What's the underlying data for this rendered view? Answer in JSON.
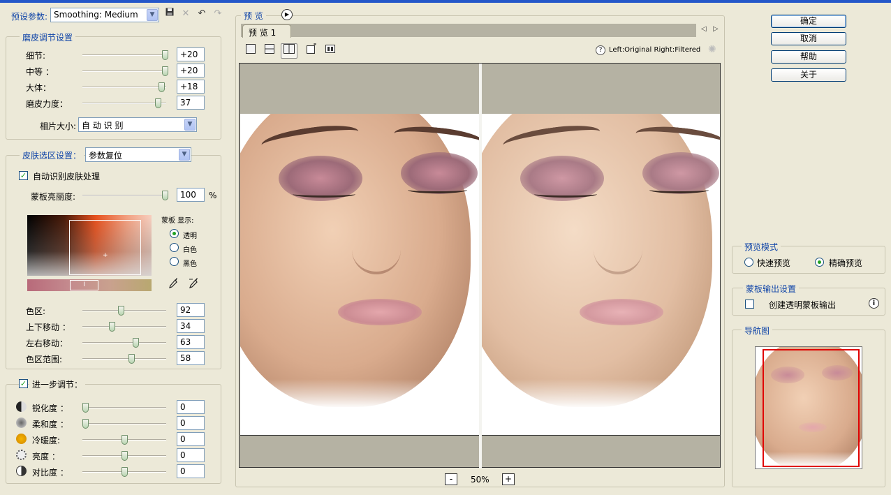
{
  "top": {
    "preset_label": "预设参数:",
    "preset_value": "Smoothing: Medium"
  },
  "smooth": {
    "legend": "磨皮调节设置",
    "rows": [
      {
        "label": "细节:",
        "value": "+20",
        "pos": 0.98
      },
      {
        "label": "中等 ：",
        "value": "+20",
        "pos": 0.98
      },
      {
        "label": "大体：",
        "value": "+18",
        "pos": 0.94
      },
      {
        "label": "磨皮力度：",
        "value": "37",
        "pos": 0.9
      }
    ],
    "photo_size_label": "相片大小:",
    "photo_size_value": "自 动 识 别"
  },
  "skin": {
    "legend": "皮肤选区设置：",
    "preset_value": "参数复位",
    "auto_label": "自动识别皮肤处理",
    "mask_brightness_label": "蒙板亮丽度:",
    "mask_brightness_value": "100",
    "mask_brightness_unit": "%",
    "mask_brightness_pos": 0.98,
    "mask_display_label": "蒙板 显示:",
    "mask_options": [
      "透明",
      "白色",
      "黑色"
    ],
    "mask_selected": 0,
    "rows": [
      {
        "label": "色区:",
        "value": "92",
        "pos": 0.46
      },
      {
        "label": "上下移动 ：",
        "value": "34",
        "pos": 0.35
      },
      {
        "label": "左右移动：",
        "value": "63",
        "pos": 0.63
      },
      {
        "label": "色区范围:",
        "value": "58",
        "pos": 0.58
      }
    ]
  },
  "further": {
    "legend": "进一步调节：",
    "rows": [
      {
        "label": "锐化度 ：",
        "value": "0",
        "icon": "half-circle-icon",
        "pos": 0.03
      },
      {
        "label": "柔和度 ：",
        "value": "0",
        "icon": "soft-circle-icon",
        "pos": 0.03
      },
      {
        "label": "冷暖度:",
        "value": "0",
        "icon": "sun-icon",
        "pos": 0.5
      },
      {
        "label": "亮度 ：",
        "value": "0",
        "icon": "brightness-icon",
        "pos": 0.5
      },
      {
        "label": "对比度 ：",
        "value": "0",
        "icon": "contrast-icon",
        "pos": 0.5
      }
    ]
  },
  "preview": {
    "legend": "预 览",
    "tab_label": "预 览 1",
    "info_text": "Left:Original Right:Filtered",
    "zoom_value": "50%",
    "zoom_minus": "-",
    "zoom_plus": "+"
  },
  "buttons": {
    "ok": "确定",
    "cancel": "取消",
    "help": "帮助",
    "about": "关于"
  },
  "preview_mode": {
    "legend": "预览模式",
    "fast": "快速预览",
    "precise": "精确预览",
    "selected": "precise"
  },
  "mask_output": {
    "legend": "蒙板输出设置",
    "create_label": "创建透明蒙板输出"
  },
  "navigator": {
    "legend": "导航图"
  },
  "colors": {
    "accent_blue": "#1045a8",
    "panel_bg": "#ece9d8",
    "preview_gray": "#b5b2a3",
    "nav_frame": "#e00000"
  }
}
